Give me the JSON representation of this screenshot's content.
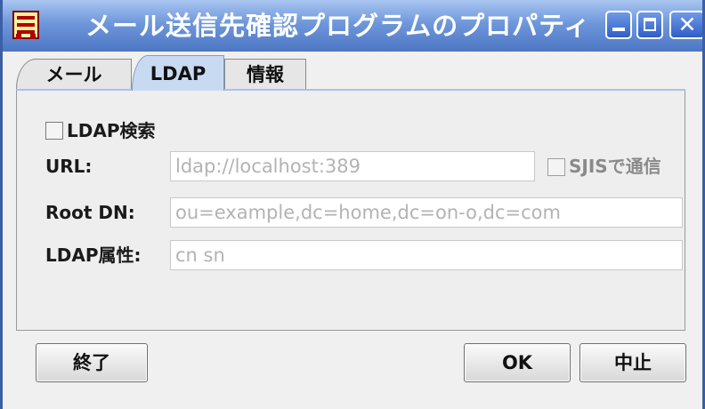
{
  "window": {
    "title": "メール送信先確認プログラムのプロパティ",
    "controls": {
      "minimize_glyph": "",
      "maximize_glyph": "",
      "close_glyph": "✕"
    }
  },
  "tabs": [
    {
      "label": "メール",
      "selected": false
    },
    {
      "label": "LDAP",
      "selected": true
    },
    {
      "label": "情報",
      "selected": false
    }
  ],
  "ldap": {
    "search_checkbox": {
      "label": "LDAP検索",
      "checked": false
    },
    "url": {
      "label": "URL:",
      "value": "ldap://localhost:389"
    },
    "sjis_checkbox": {
      "label": "SJISで通信",
      "checked": false,
      "enabled": false
    },
    "root_dn": {
      "label": "Root DN:",
      "value": "ou=example,dc=home,dc=on-o,dc=com"
    },
    "attributes": {
      "label": "LDAP属性:",
      "value": "cn sn"
    }
  },
  "buttons": {
    "exit": "終了",
    "ok": "OK",
    "cancel": "中止"
  },
  "colors": {
    "titlebar_top": "#a9c5f0",
    "titlebar_bottom": "#4d76c4",
    "selected_tab": "#c8daf2",
    "panel_bg": "#eeeeee",
    "disabled_text": "#b3b3b3"
  },
  "icons": {
    "app": "app-icon",
    "minimize": "minimize-icon",
    "maximize": "maximize-icon",
    "close": "close-icon"
  }
}
